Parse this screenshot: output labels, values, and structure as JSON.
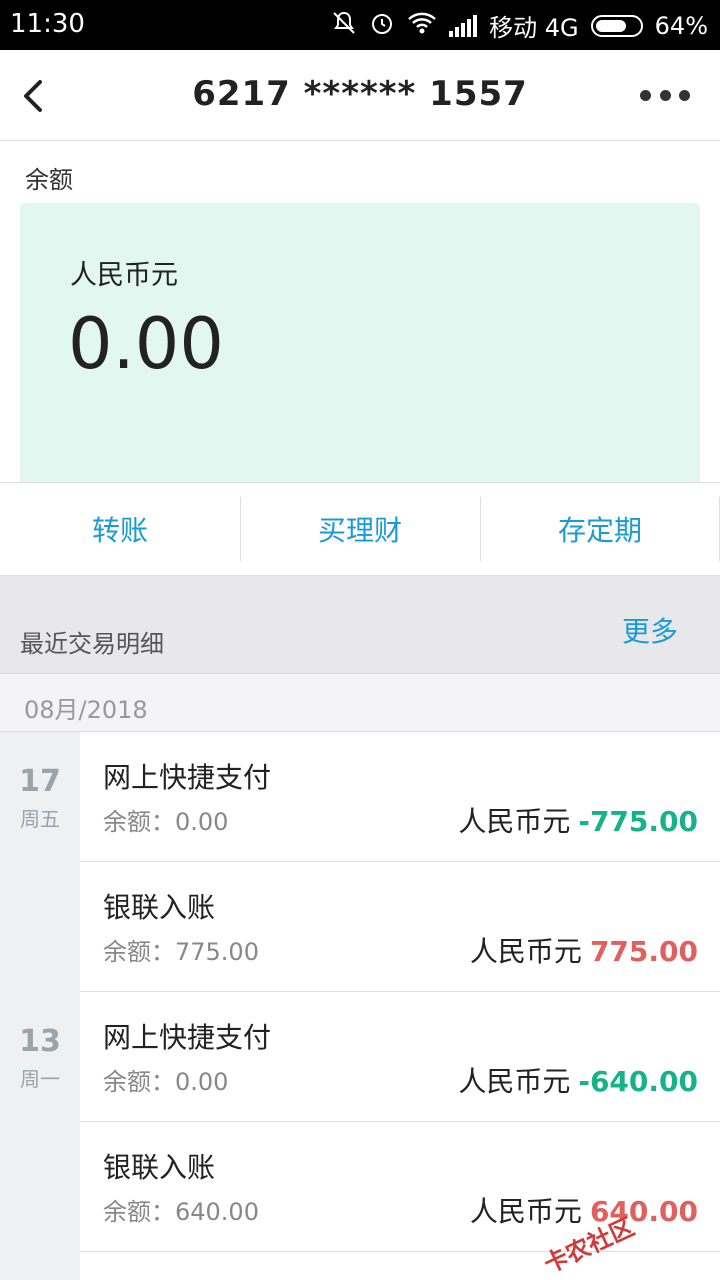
{
  "status_bar": {
    "time": "11:30",
    "carrier": "移动 4G",
    "battery": "64%"
  },
  "header": {
    "title": "6217 ****** 1557"
  },
  "balance": {
    "label": "余额",
    "currency": "人民币元",
    "amount": "0.00"
  },
  "actions": [
    "转账",
    "买理财",
    "存定期"
  ],
  "recent": {
    "title": "最近交易明细",
    "more": "更多",
    "month": "08月/2018"
  },
  "dates": [
    {
      "day": "17",
      "weekday": "周五"
    },
    {
      "day": "13",
      "weekday": "周一"
    }
  ],
  "transactions": [
    {
      "name": "网上快捷支付",
      "balance": "余额：0.00",
      "currency": "人民币元",
      "amount": "-775.00"
    },
    {
      "name": "银联入账",
      "balance": "余额：775.00",
      "currency": "人民币元",
      "amount": "775.00"
    },
    {
      "name": "网上快捷支付",
      "balance": "余额：0.00",
      "currency": "人民币元",
      "amount": "-640.00"
    },
    {
      "name": "银联入账",
      "balance": "余额：640.00",
      "currency": "人民币元",
      "amount": "640.00"
    }
  ],
  "watermark": {
    "text": "卡农社区"
  },
  "colors": {
    "accent": "#1a9bd7",
    "debit": "#16b38a",
    "credit": "#e0605e",
    "card_bg": "#e2f7ef"
  }
}
